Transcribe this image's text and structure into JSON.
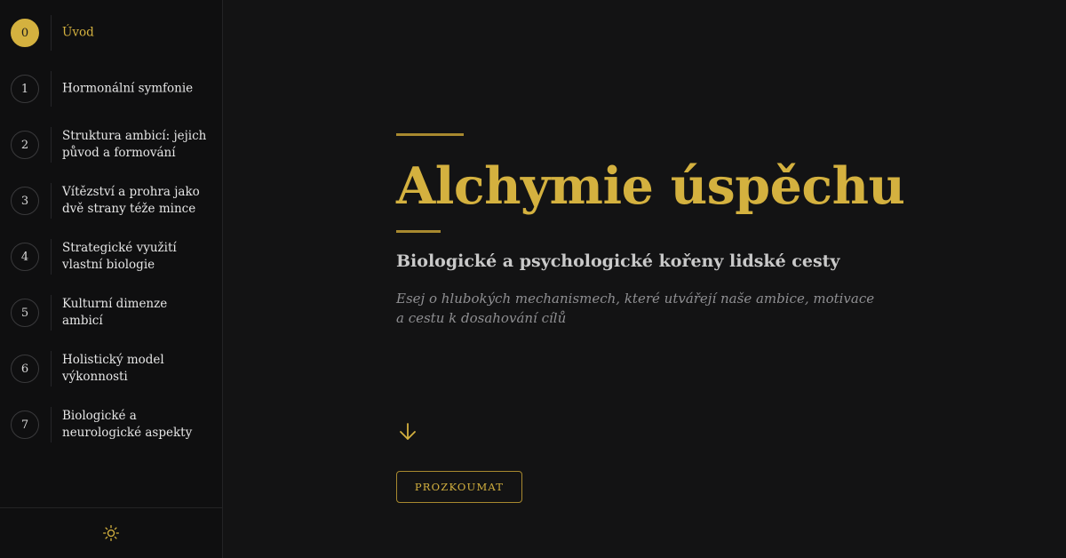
{
  "sidebar": {
    "items": [
      {
        "num": "0",
        "label": "Úvod",
        "active": true
      },
      {
        "num": "1",
        "label": "Hormonální symfonie"
      },
      {
        "num": "2",
        "label": "Struktura ambicí: jejich původ a formování"
      },
      {
        "num": "3",
        "label": "Vítězství a prohra jako dvě strany téže mince"
      },
      {
        "num": "4",
        "label": "Strategické využití vlastní biologie"
      },
      {
        "num": "5",
        "label": "Kulturní dimenze ambicí"
      },
      {
        "num": "6",
        "label": "Holistický model výkonnosti"
      },
      {
        "num": "7",
        "label": "Biologické a neurologické aspekty"
      }
    ],
    "footer_icon": "sun-icon"
  },
  "hero": {
    "title": "Alchymie úspěchu",
    "subtitle": "Biologické a psychologické kořeny lidské cesty",
    "description": "Esej o hlubokých mechanismech, které utvářejí naše ambice, motivace a cestu k dosahování cílů",
    "scroll_icon": "arrow-down-icon",
    "cta_label": "PROZKOUMAT"
  },
  "colors": {
    "background": "#131314",
    "sidebar": "#0f0f10",
    "accent": "#d4b13f",
    "text": "#e6e6e6",
    "muted": "#8f8f92"
  }
}
